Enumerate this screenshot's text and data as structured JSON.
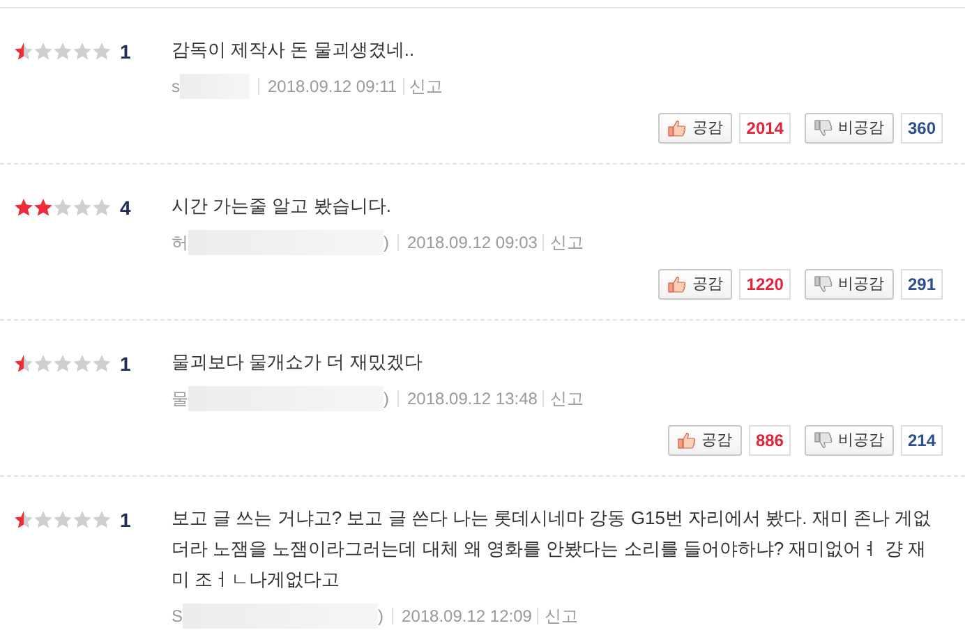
{
  "reviews": [
    {
      "stars": 0.5,
      "score": "1",
      "text": "감독이 제작사 돈 물괴생겼네..",
      "user": "s",
      "date": "2018.09.12 09:11",
      "report": "신고",
      "like": {
        "label": "공감",
        "count": "2014"
      },
      "dislike": {
        "label": "비공감",
        "count": "360"
      }
    },
    {
      "stars": 2,
      "score": "4",
      "text": "시간 가는줄 알고 봤습니다.",
      "user": "허",
      "user_end": ")",
      "date": "2018.09.12 09:03",
      "report": "신고",
      "like": {
        "label": "공감",
        "count": "1220"
      },
      "dislike": {
        "label": "비공감",
        "count": "291"
      }
    },
    {
      "stars": 0.5,
      "score": "1",
      "text": "물괴보다 물개쇼가 더 재밌겠다",
      "user": "물",
      "user_end": ")",
      "date": "2018.09.12 13:48",
      "report": "신고",
      "like": {
        "label": "공감",
        "count": "886"
      },
      "dislike": {
        "label": "비공감",
        "count": "214"
      }
    },
    {
      "stars": 0.5,
      "score": "1",
      "text": "보고 글 쓰는 거냐고? 보고 글 쓴다 나는 롯데시네마 강동 G15번 자리에서 봤다. 재미 존나 게없더라 노잼을 노잼이라그러는데 대체 왜 영화를 안봤다는 소리를 들어야하냐? 재미없어ㅕ 걍 재미 조ㅓㄴ나게없다고",
      "user": "S",
      "user_end": ")",
      "date": "2018.09.12 12:09",
      "report": "신고"
    }
  ]
}
